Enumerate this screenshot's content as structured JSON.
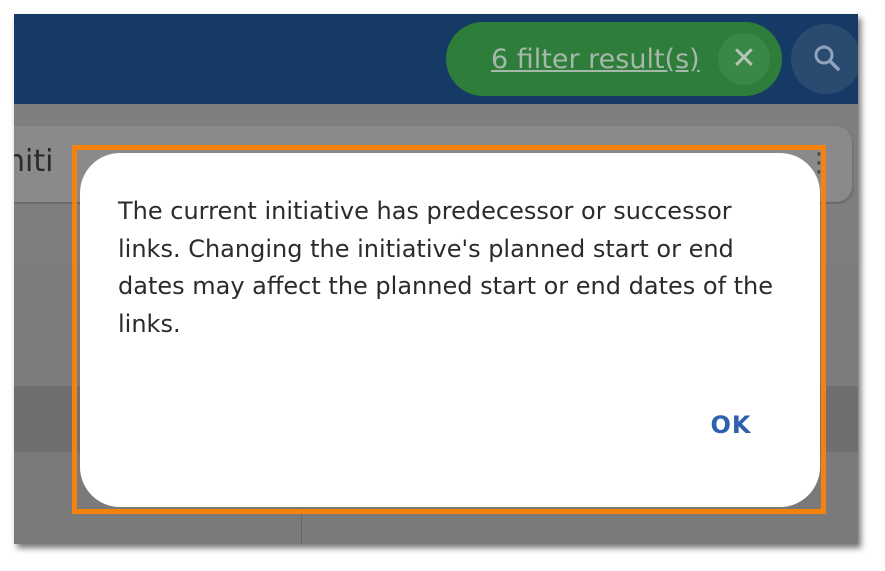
{
  "header": {
    "filter_chip": {
      "label": "6 filter result(s)",
      "close_glyph": "✕",
      "close_icon": "close-icon"
    },
    "search_icon": "search-icon"
  },
  "background": {
    "card_title_fragment": "niti",
    "kebab_glyph": "⋮"
  },
  "dialog": {
    "message": "The current initiative has predecessor or successor links. Changing the initiative's planned start or end dates may affect the planned start or end dates of the links.",
    "ok_label": "OK"
  },
  "colors": {
    "highlight": "#f5820d",
    "app_bar": "#163a66",
    "chip": "#2f7d3a",
    "ok_text": "#2f5fae"
  }
}
